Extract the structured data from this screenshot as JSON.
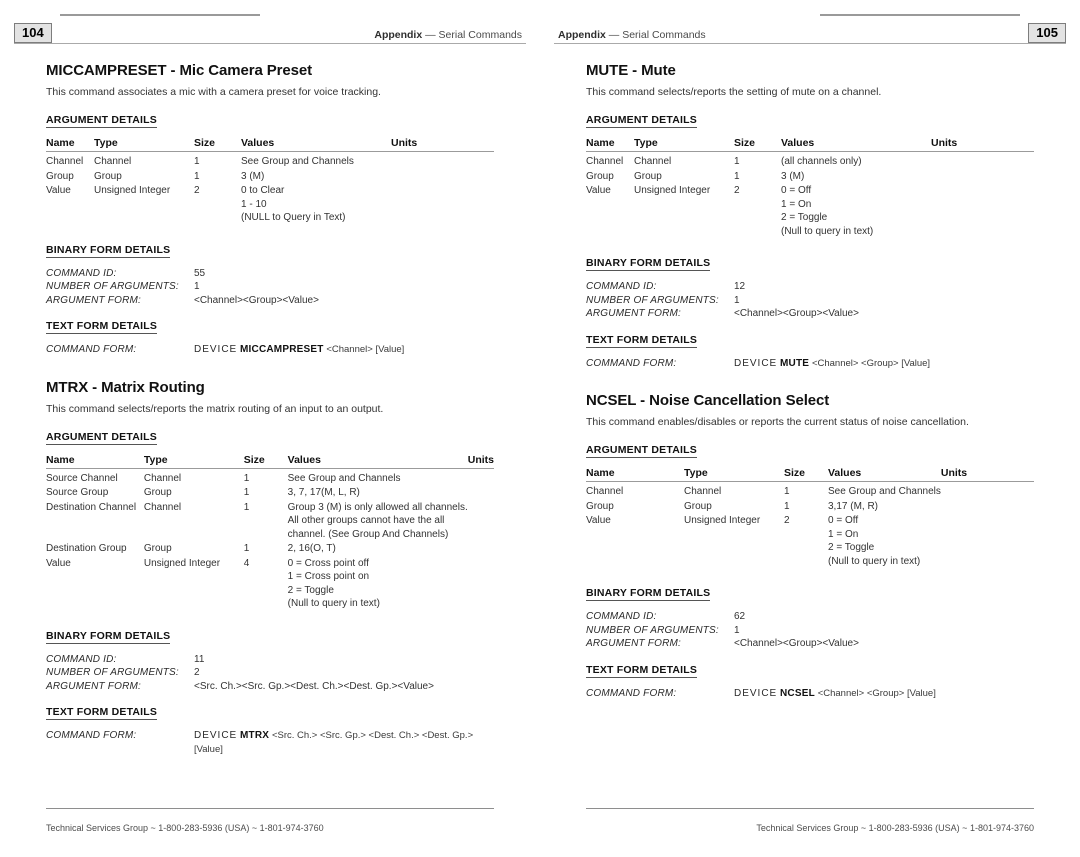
{
  "footer_text": "Technical Services Group ~ 1-800-283-5936 (USA) ~ 1-801-974-3760",
  "pages": [
    {
      "number": "104",
      "running_head_prefix": "Appendix",
      "running_head_dash": " — ",
      "running_head_title": "Serial Commands",
      "commands": [
        {
          "title": "MICCAMPRESET - Mic Camera Preset",
          "description": "This command associates a mic with a camera preset for voice tracking.",
          "argument_details_label": "ARGUMENT DETAILS",
          "table_variant": "wide",
          "columns": [
            "Name",
            "Type",
            "Size",
            "Values",
            "Units"
          ],
          "rows": [
            {
              "name": "Channel",
              "type": "Channel",
              "size": "1",
              "values": [
                "See Group and Channels"
              ],
              "units": ""
            },
            {
              "name": "Group",
              "type": "Group",
              "size": "1",
              "values": [
                "3 (M)"
              ],
              "units": ""
            },
            {
              "name": "Value",
              "type": "Unsigned Integer",
              "size": "2",
              "values": [
                "0 to Clear",
                "1 - 10",
                "(NULL to Query in Text)"
              ],
              "units": ""
            }
          ],
          "binary_label": "BINARY FORM DETAILS",
          "binary": [
            {
              "key": "COMMAND ID:",
              "value": "55"
            },
            {
              "key": "NUMBER OF ARGUMENTS:",
              "value": "1"
            },
            {
              "key": "ARGUMENT FORM:",
              "value": "<Channel><Group><Value>"
            }
          ],
          "text_label": "TEXT FORM DETAILS",
          "text_form_key": "COMMAND FORM:",
          "text_form_device": "DEVICE",
          "text_form_cmd": "MICCAMPRESET",
          "text_form_args": "<Channel> [Value]",
          "text_form_args_line2": ""
        },
        {
          "title": "MTRX - Matrix Routing",
          "description": "This command selects/reports the matrix routing of an input to an output.",
          "argument_details_label": "ARGUMENT DETAILS",
          "table_variant": "narrow",
          "columns": [
            "Name",
            "Type",
            "Size",
            "Values",
            "Units"
          ],
          "rows": [
            {
              "name": "Source Channel",
              "type": "Channel",
              "size": "1",
              "values": [
                "See Group and Channels"
              ],
              "units": ""
            },
            {
              "name": "Source Group",
              "type": "Group",
              "size": "1",
              "values": [
                "3, 7, 17(M, L, R)"
              ],
              "units": ""
            },
            {
              "name": "Destination Channel",
              "type": "Channel",
              "size": "1",
              "values": [
                "Group 3 (M) is only allowed all channels.",
                "All other groups cannot have the all",
                "channel. (See Group And Channels)"
              ],
              "units": ""
            },
            {
              "name": "Destination Group",
              "type": "Group",
              "size": "1",
              "values": [
                "2, 16(O, T)"
              ],
              "units": ""
            },
            {
              "name": "Value",
              "type": "Unsigned Integer",
              "size": "4",
              "values": [
                "0 = Cross point off",
                "1 = Cross point on",
                "2 = Toggle",
                "(Null to query in text)"
              ],
              "units": ""
            }
          ],
          "binary_label": "BINARY FORM DETAILS",
          "binary": [
            {
              "key": "COMMAND ID:",
              "value": "11"
            },
            {
              "key": "NUMBER OF ARGUMENTS:",
              "value": "2"
            },
            {
              "key": "ARGUMENT FORM:",
              "value": "<Src. Ch.><Src. Gp.><Dest. Ch.><Dest. Gp.><Value>"
            }
          ],
          "text_label": "TEXT FORM DETAILS",
          "text_form_key": "COMMAND FORM:",
          "text_form_device": "DEVICE",
          "text_form_cmd": "MTRX",
          "text_form_args": "<Src. Ch.> <Src. Gp.> <Dest. Ch.> <Dest. Gp.>",
          "text_form_args_line2": "[Value]"
        }
      ]
    },
    {
      "number": "105",
      "running_head_prefix": "Appendix",
      "running_head_dash": " — ",
      "running_head_title": "Serial Commands",
      "commands": [
        {
          "title": "MUTE - Mute",
          "description": "This command selects/reports the setting of mute on a channel.",
          "argument_details_label": "ARGUMENT DETAILS",
          "table_variant": "wide",
          "columns": [
            "Name",
            "Type",
            "Size",
            "Values",
            "Units"
          ],
          "rows": [
            {
              "name": "Channel",
              "type": "Channel",
              "size": "1",
              "values": [
                "(all channels only)"
              ],
              "units": ""
            },
            {
              "name": "Group",
              "type": "Group",
              "size": "1",
              "values": [
                "3 (M)"
              ],
              "units": ""
            },
            {
              "name": "Value",
              "type": "Unsigned Integer",
              "size": "2",
              "values": [
                "0 = Off",
                "1 = On",
                "2 = Toggle",
                "(Null to query in text)"
              ],
              "units": ""
            }
          ],
          "binary_label": "BINARY FORM DETAILS",
          "binary": [
            {
              "key": "COMMAND ID:",
              "value": "12"
            },
            {
              "key": "NUMBER OF ARGUMENTS:",
              "value": "1"
            },
            {
              "key": "ARGUMENT FORM:",
              "value": "<Channel><Group><Value>"
            }
          ],
          "text_label": "TEXT FORM DETAILS",
          "text_form_key": "COMMAND FORM:",
          "text_form_device": "DEVICE",
          "text_form_cmd": "MUTE",
          "text_form_args": "<Channel> <Group> [Value]",
          "text_form_args_line2": ""
        },
        {
          "title": "NCSEL - Noise Cancellation Select",
          "description": "This command enables/disables or reports the current status of noise cancellation.",
          "argument_details_label": "ARGUMENT DETAILS",
          "table_variant": "narrow",
          "columns": [
            "Name",
            "Type",
            "Size",
            "Values",
            "Units"
          ],
          "rows": [
            {
              "name": "Channel",
              "type": "Channel",
              "size": "1",
              "values": [
                "See Group and Channels"
              ],
              "units": ""
            },
            {
              "name": "Group",
              "type": "Group",
              "size": "1",
              "values": [
                "3,17 (M, R)"
              ],
              "units": ""
            },
            {
              "name": "Value",
              "type": "Unsigned Integer",
              "size": "2",
              "values": [
                "0 = Off",
                "1 = On",
                "2 = Toggle",
                "(Null to query in text)"
              ],
              "units": ""
            }
          ],
          "binary_label": "BINARY FORM DETAILS",
          "binary": [
            {
              "key": "COMMAND ID:",
              "value": "62"
            },
            {
              "key": "NUMBER OF ARGUMENTS:",
              "value": "1"
            },
            {
              "key": "ARGUMENT FORM:",
              "value": "<Channel><Group><Value>"
            }
          ],
          "text_label": "TEXT FORM DETAILS",
          "text_form_key": "COMMAND FORM:",
          "text_form_device": "DEVICE",
          "text_form_cmd": "NCSEL",
          "text_form_args": "<Channel> <Group> [Value]",
          "text_form_args_line2": ""
        }
      ]
    }
  ]
}
